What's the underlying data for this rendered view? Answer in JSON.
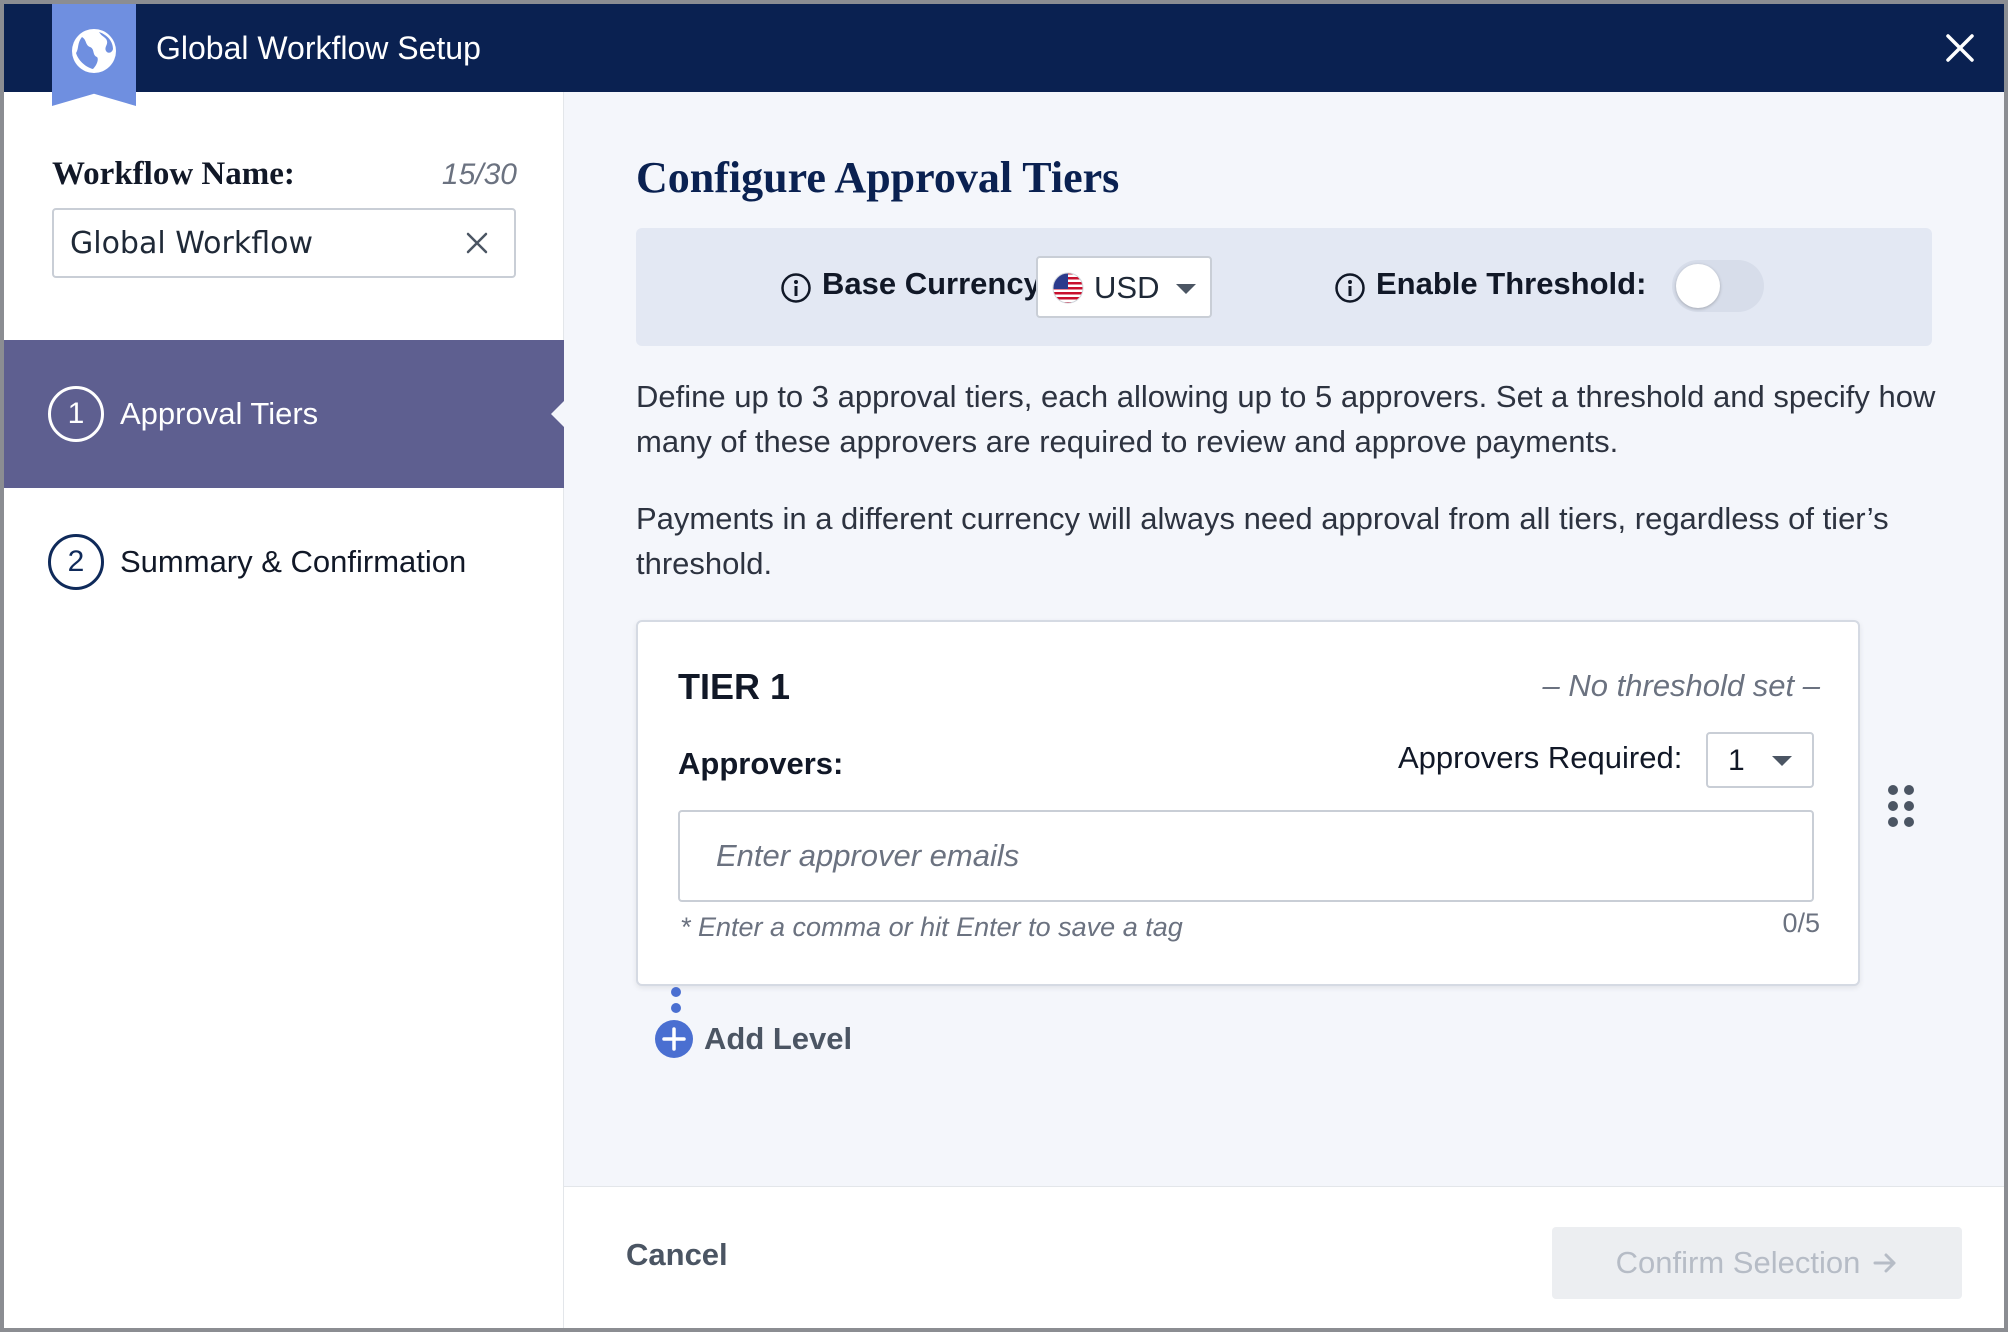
{
  "header": {
    "title": "Global Workflow Setup",
    "badge_icon": "globe-icon",
    "close_icon": "close-icon"
  },
  "sidebar": {
    "workflow_name_label": "Workflow Name:",
    "char_count": "15/30",
    "workflow_name_value": "Global Workflow",
    "steps": [
      {
        "number": "1",
        "label": "Approval Tiers",
        "active": true
      },
      {
        "number": "2",
        "label": "Summary & Confirmation",
        "active": false
      }
    ]
  },
  "main": {
    "title": "Configure Approval Tiers",
    "config": {
      "currency_label": "Base Currency:",
      "currency_value": "USD",
      "currency_flag_icon": "us-flag-icon",
      "threshold_label": "Enable Threshold:",
      "threshold_enabled": false
    },
    "description_1": "Define up to 3 approval tiers, each allowing up to 5 approvers. Set a threshold and specify how many of these approvers are required to review and approve payments.",
    "description_2": "Payments in a different currency will always need approval from all tiers, regardless of tier’s threshold.",
    "tier": {
      "title": "TIER 1",
      "threshold_text": "– No threshold set –",
      "approvers_label": "Approvers:",
      "required_label": "Approvers Required:",
      "required_value": "1",
      "email_placeholder": "Enter approver emails",
      "hint": "* Enter a comma or hit Enter to save a tag",
      "count": "0/5"
    },
    "add_level_label": "Add Level"
  },
  "footer": {
    "cancel_label": "Cancel",
    "confirm_label": "Confirm Selection"
  },
  "colors": {
    "header_bg": "#0a2151",
    "badge": "#6f8fe0",
    "active_step": "#5e5f90",
    "accent": "#4a6fd1"
  }
}
